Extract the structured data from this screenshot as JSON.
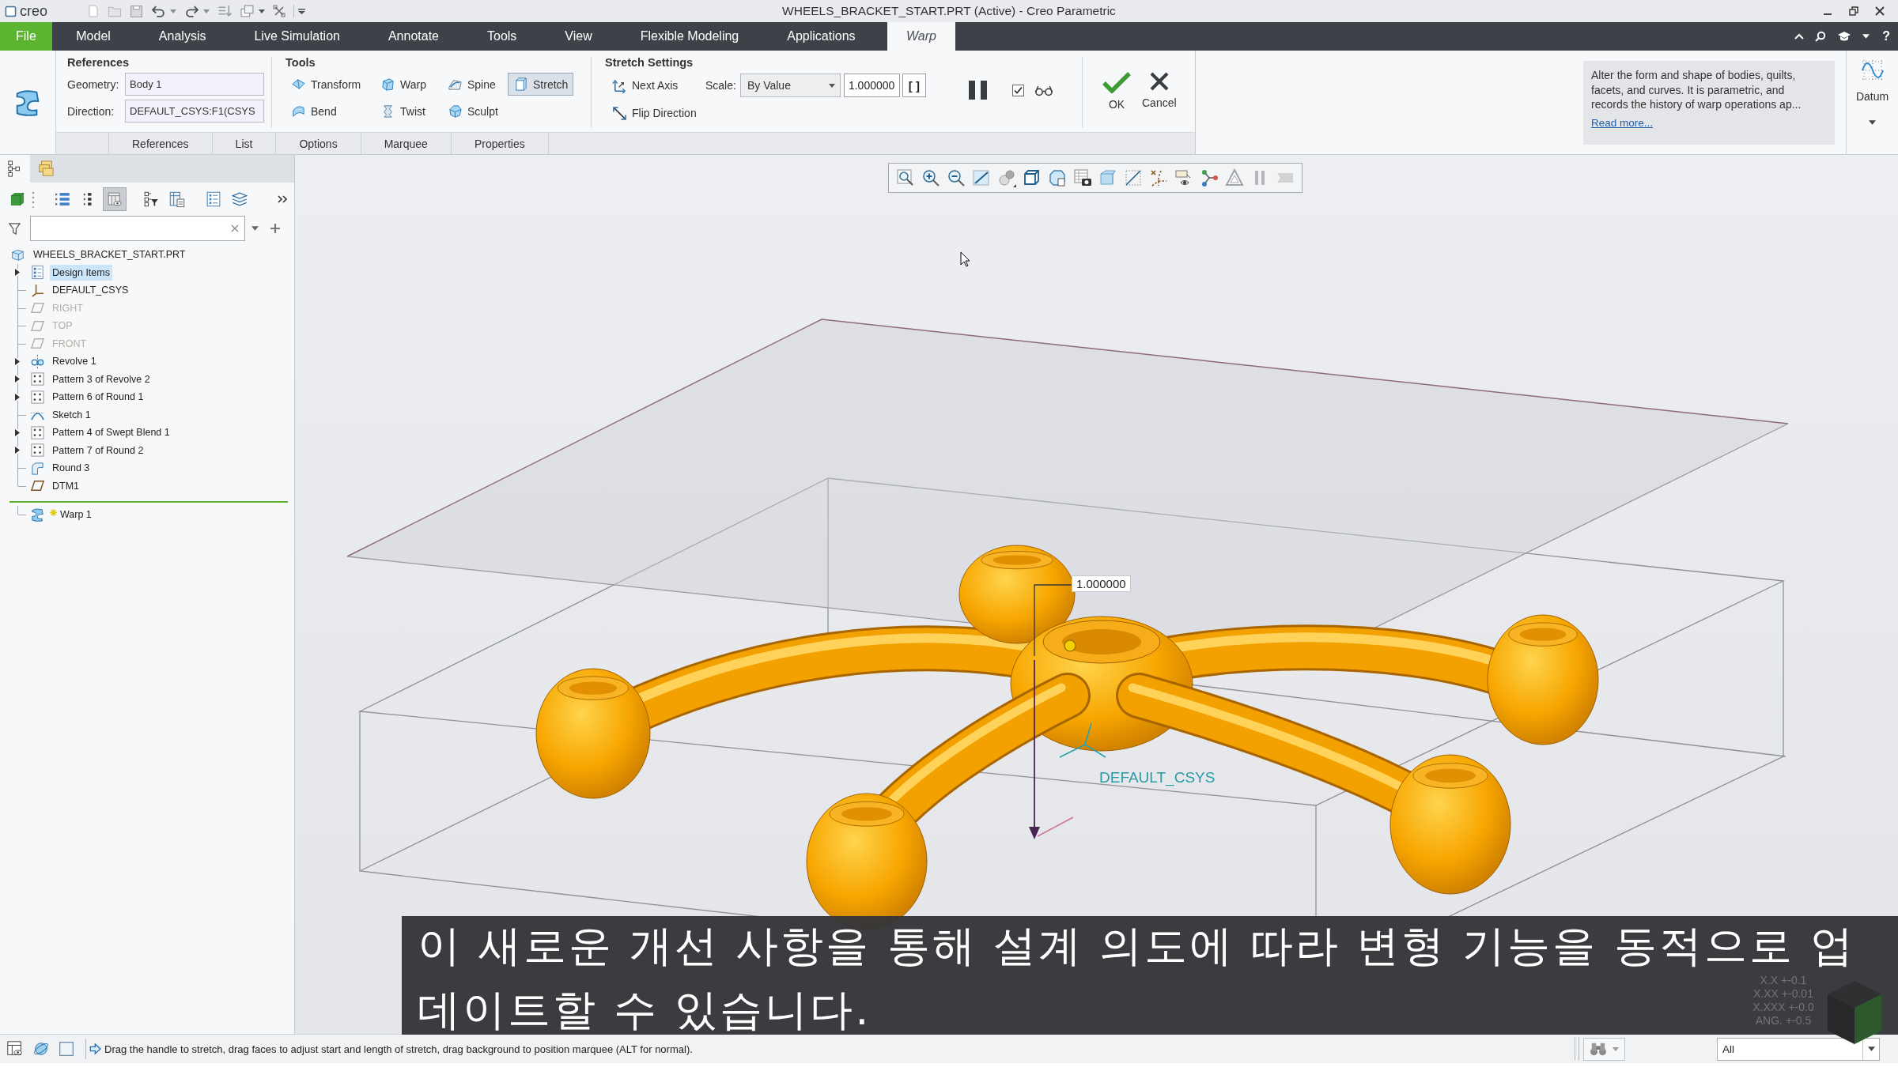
{
  "title_bar": {
    "app_name": "creo",
    "title": "WHEELS_BRACKET_START.PRT (Active) - Creo Parametric"
  },
  "ribbon_tabs": [
    {
      "label": "File",
      "kind": "file",
      "selected": false
    },
    {
      "label": "Model",
      "kind": "tab",
      "selected": false
    },
    {
      "label": "Analysis",
      "kind": "tab",
      "selected": false
    },
    {
      "label": "Live Simulation",
      "kind": "tab",
      "selected": false
    },
    {
      "label": "Annotate",
      "kind": "tab",
      "selected": false
    },
    {
      "label": "Tools",
      "kind": "tab",
      "selected": false
    },
    {
      "label": "View",
      "kind": "tab",
      "selected": false
    },
    {
      "label": "Flexible Modeling",
      "kind": "tab",
      "selected": false
    },
    {
      "label": "Applications",
      "kind": "tab",
      "selected": false
    },
    {
      "label": "Warp",
      "kind": "contextual",
      "selected": true
    }
  ],
  "help_button": "?",
  "ribbon": {
    "references": {
      "title": "References",
      "fields": [
        {
          "label": "Geometry:",
          "value": "Body 1"
        },
        {
          "label": "Direction:",
          "value": "DEFAULT_CSYS:F1(CSYS"
        }
      ]
    },
    "tools": {
      "title": "Tools",
      "items": [
        {
          "label": "Transform",
          "kind": "transform",
          "selected": false
        },
        {
          "label": "Warp",
          "kind": "warp",
          "selected": false
        },
        {
          "label": "Spine",
          "kind": "spine",
          "selected": false
        },
        {
          "label": "Stretch",
          "kind": "stretch",
          "selected": true
        },
        {
          "label": "Bend",
          "kind": "bend",
          "selected": false
        },
        {
          "label": "Twist",
          "kind": "twist",
          "selected": false
        },
        {
          "label": "Sculpt",
          "kind": "sculpt",
          "selected": false
        }
      ]
    },
    "stretch_settings": {
      "title": "Stretch Settings",
      "next_axis": "Next Axis",
      "flip_direction": "Flip Direction",
      "scale_label": "Scale:",
      "scale_mode": "By Value",
      "scale_value": "1.000000",
      "bracket_button": "[ ]"
    },
    "preview_checked": true,
    "ok": "OK",
    "cancel": "Cancel",
    "help_text": "Alter the form and shape of bodies, quilts, facets, and curves. It is parametric, and records the history of warp operations ap...",
    "read_more": "Read more...",
    "datum": "Datum"
  },
  "dashboard_tabs": [
    {
      "label": "References",
      "selected": false
    },
    {
      "label": "List",
      "selected": false
    },
    {
      "label": "Options",
      "selected": false
    },
    {
      "label": "Marquee",
      "selected": false
    },
    {
      "label": "Properties",
      "selected": false
    }
  ],
  "panel_tabs": [
    {
      "kind": "model-tree",
      "selected": true
    },
    {
      "kind": "folders",
      "selected": false
    }
  ],
  "tree_toolbar": [
    [
      {
        "kind": "list-bars",
        "selected": false
      },
      {
        "kind": "dot-list",
        "selected": false
      },
      {
        "kind": "table-eye",
        "selected": true
      }
    ],
    [
      {
        "kind": "tree-funnel",
        "selected": false
      },
      {
        "kind": "table-document",
        "selected": false
      }
    ],
    [
      {
        "kind": "list-document",
        "selected": false
      },
      {
        "kind": "layers",
        "selected": false
      }
    ]
  ],
  "model_tree": {
    "root": {
      "label": "WHEELS_BRACKET_START.PRT",
      "children": [
        {
          "label": "Design Items",
          "kind": "design-items",
          "expandable": true,
          "selected": true,
          "hidden": false,
          "pending": false
        },
        {
          "label": "DEFAULT_CSYS",
          "kind": "csys",
          "expandable": false,
          "selected": false,
          "hidden": false,
          "pending": false
        },
        {
          "label": "RIGHT",
          "kind": "plane",
          "expandable": false,
          "selected": false,
          "hidden": true,
          "pending": false
        },
        {
          "label": "TOP",
          "kind": "plane",
          "expandable": false,
          "selected": false,
          "hidden": true,
          "pending": false
        },
        {
          "label": "FRONT",
          "kind": "plane",
          "expandable": false,
          "selected": false,
          "hidden": true,
          "pending": false
        },
        {
          "label": "Revolve 1",
          "kind": "revolve",
          "expandable": true,
          "selected": false,
          "hidden": false,
          "pending": false
        },
        {
          "label": "Pattern 3 of Revolve 2",
          "kind": "pattern",
          "expandable": true,
          "selected": false,
          "hidden": false,
          "pending": false
        },
        {
          "label": "Pattern 6 of Round 1",
          "kind": "pattern",
          "expandable": true,
          "selected": false,
          "hidden": false,
          "pending": false
        },
        {
          "label": "Sketch 1",
          "kind": "sketch",
          "expandable": false,
          "selected": false,
          "hidden": false,
          "pending": false
        },
        {
          "label": "Pattern 4 of Swept Blend 1",
          "kind": "pattern",
          "expandable": true,
          "selected": false,
          "hidden": false,
          "pending": false
        },
        {
          "label": "Pattern 7 of Round 2",
          "kind": "pattern",
          "expandable": true,
          "selected": false,
          "hidden": false,
          "pending": false
        },
        {
          "label": "Round 3",
          "kind": "round",
          "expandable": false,
          "selected": false,
          "hidden": false,
          "pending": false
        },
        {
          "label": "DTM1",
          "kind": "plane",
          "expandable": false,
          "selected": false,
          "hidden": false,
          "pending": false
        },
        {
          "label": "Warp 1",
          "kind": "warp",
          "expandable": false,
          "selected": false,
          "hidden": false,
          "pending": true
        }
      ]
    }
  },
  "view_toolbar": [
    {
      "kind": "refit",
      "disabled": false
    },
    {
      "kind": "zoom-in",
      "disabled": false
    },
    {
      "kind": "zoom-out",
      "disabled": false
    },
    {
      "kind": "repaint",
      "disabled": false
    },
    {
      "kind": "shading",
      "disabled": false
    },
    {
      "kind": "display-style",
      "disabled": false
    },
    {
      "kind": "saved-views",
      "disabled": false
    },
    {
      "kind": "view-manager",
      "disabled": false
    },
    {
      "kind": "section",
      "disabled": false
    },
    {
      "kind": "datum-display",
      "disabled": false
    },
    {
      "kind": "point-display",
      "disabled": false
    },
    {
      "kind": "annotation-display",
      "disabled": false
    },
    {
      "kind": "spin-center",
      "disabled": false
    },
    {
      "kind": "triangle",
      "disabled": false
    },
    {
      "kind": "pause",
      "disabled": true
    },
    {
      "kind": "tag",
      "disabled": true
    }
  ],
  "viewport": {
    "dimension_value": "1.000000",
    "csys_label": "DEFAULT_CSYS",
    "tolerances": [
      "X.X +-0.1",
      "X.XX +-0.01",
      "X.XXX +-0.0",
      "ANG. +-0.5"
    ]
  },
  "subtitle": {
    "lines": [
      "이 새로운 개선 사항을 통해 설계 의도에 따라 변형 기능을 동적으로 업",
      "데이트할 수 있습니다."
    ]
  },
  "status_bar": {
    "message": "Drag the handle to stretch, drag faces to adjust start and length of stretch, drag background to position marquee (ALT for normal).",
    "filter": "All"
  }
}
